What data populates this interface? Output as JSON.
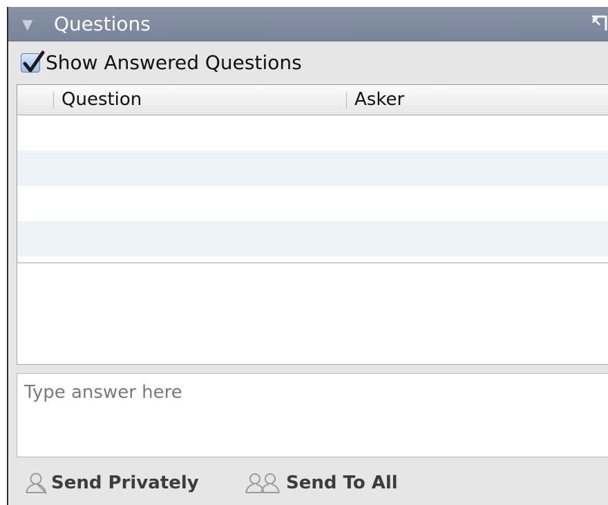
{
  "panel": {
    "title": "Questions",
    "collapse_icon": "triangle-down-icon",
    "popout_icon": "popout-window-icon"
  },
  "filter": {
    "show_answered_label": "Show Answered Questions",
    "show_answered_checked": true
  },
  "table": {
    "columns": [
      "Question",
      "Asker"
    ],
    "rows": []
  },
  "answer": {
    "placeholder": "Type answer here",
    "value": ""
  },
  "actions": {
    "send_privately_label": "Send Privately",
    "send_privately_icon": "single-person-icon",
    "send_to_all_label": "Send To All",
    "send_to_all_icon": "two-people-icon"
  },
  "colors": {
    "titlebar": "#7f8ba0",
    "row_stripe": "#edf3f8",
    "panel_bg": "#e6e6e6"
  }
}
